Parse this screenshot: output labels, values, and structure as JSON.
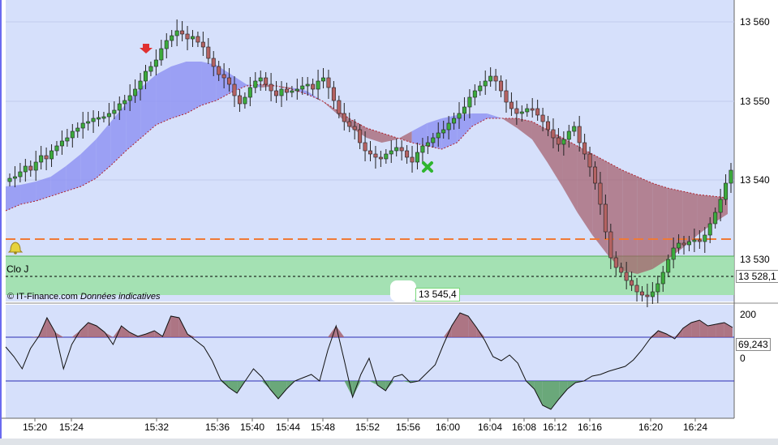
{
  "price_axis": {
    "ticks": [
      "13 560",
      "13 550",
      "13 540",
      "13 530"
    ],
    "current_price": "13 528,1"
  },
  "time_axis": {
    "ticks": [
      "15:20",
      "15:24",
      "15:32",
      "15:36",
      "15:40",
      "15:44",
      "15:48",
      "15:52",
      "15:56",
      "16:00",
      "16:04",
      "16:08",
      "16:12",
      "16:16",
      "16:20",
      "16:24"
    ]
  },
  "overlay": {
    "level_label": "Clo J",
    "copyright": "© IT-Finance.com",
    "data_note": "Données indicatives",
    "hover_value": "13 545,4"
  },
  "oscillator": {
    "ticks": [
      "200",
      "0"
    ],
    "current_value": "69,243"
  },
  "colors": {
    "background": "#d6e0fb",
    "bullish_candle": "#3caa3c",
    "bearish_candle": "#b46262",
    "cloud_blue": "#8c90f2",
    "cloud_red": "#a35a66",
    "support_zone": "#9be0a6",
    "orange_line": "#f07a36"
  },
  "icons": [
    "down-arrow-icon",
    "cross-signal-icon",
    "alert-bell-icon"
  ]
}
